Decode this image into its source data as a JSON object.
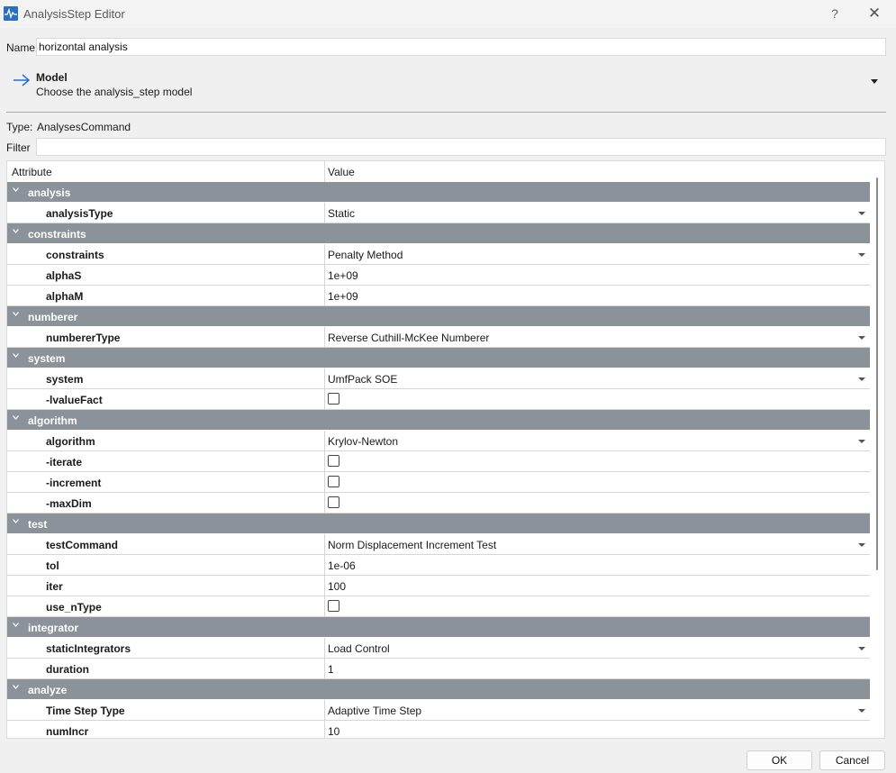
{
  "window": {
    "title": "AnalysisStep Editor",
    "help": "?",
    "close": "✕"
  },
  "name_field": {
    "label": "Name",
    "value": "horizontal analysis"
  },
  "model": {
    "title": "Model",
    "subtitle": "Choose the analysis_step model"
  },
  "type": {
    "label": "Type:",
    "value": "AnalysesCommand"
  },
  "filter": {
    "label": "Filter",
    "value": ""
  },
  "table": {
    "headers": [
      "Attribute",
      "Value"
    ],
    "groups": [
      {
        "name": "analysis",
        "items": [
          {
            "attr": "analysisType",
            "kind": "dropdown",
            "value": "Static"
          }
        ]
      },
      {
        "name": "constraints",
        "items": [
          {
            "attr": "constraints",
            "kind": "dropdown",
            "value": "Penalty Method"
          },
          {
            "attr": "alphaS",
            "kind": "text",
            "value": "1e+09"
          },
          {
            "attr": "alphaM",
            "kind": "text",
            "value": "1e+09"
          }
        ]
      },
      {
        "name": "numberer",
        "items": [
          {
            "attr": "numbererType",
            "kind": "dropdown",
            "value": "Reverse Cuthill-McKee Numberer"
          }
        ]
      },
      {
        "name": "system",
        "items": [
          {
            "attr": "system",
            "kind": "dropdown",
            "value": "UmfPack SOE"
          },
          {
            "attr": "-lvalueFact",
            "kind": "checkbox",
            "checked": false
          }
        ]
      },
      {
        "name": "algorithm",
        "items": [
          {
            "attr": "algorithm",
            "kind": "dropdown",
            "value": "Krylov-Newton"
          },
          {
            "attr": "-iterate",
            "kind": "checkbox",
            "checked": false
          },
          {
            "attr": "-increment",
            "kind": "checkbox",
            "checked": false
          },
          {
            "attr": "-maxDim",
            "kind": "checkbox",
            "checked": false
          }
        ]
      },
      {
        "name": "test",
        "items": [
          {
            "attr": "testCommand",
            "kind": "dropdown",
            "value": "Norm Displacement Increment Test"
          },
          {
            "attr": "tol",
            "kind": "text",
            "value": "1e-06"
          },
          {
            "attr": "iter",
            "kind": "text",
            "value": "100"
          },
          {
            "attr": "use_nType",
            "kind": "checkbox",
            "checked": false
          }
        ]
      },
      {
        "name": "integrator",
        "items": [
          {
            "attr": "staticIntegrators",
            "kind": "dropdown",
            "value": "Load Control"
          },
          {
            "attr": "duration",
            "kind": "text",
            "value": "1"
          }
        ]
      },
      {
        "name": "analyze",
        "items": [
          {
            "attr": "Time Step Type",
            "kind": "dropdown",
            "value": "Adaptive Time Step"
          },
          {
            "attr": "numIncr",
            "kind": "text",
            "value": "10"
          }
        ]
      }
    ]
  },
  "buttons": {
    "ok": "OK",
    "cancel": "Cancel"
  },
  "colors": {
    "group_header": "#8b9299",
    "accent": "#1e73d2"
  }
}
